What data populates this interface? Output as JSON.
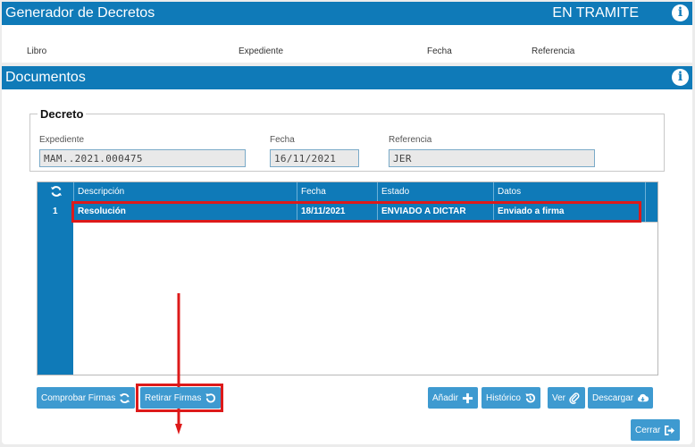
{
  "top": {
    "title": "Generador de Decretos",
    "state": "EN TRAMITE",
    "cut_labels": [
      "Libro",
      "Expediente",
      "Fecha",
      "Referencia"
    ]
  },
  "docs": {
    "title": "Documentos",
    "decreto": {
      "legend": "Decreto",
      "expediente_label": "Expediente",
      "expediente_value": "MAM..2021.000475",
      "fecha_label": "Fecha",
      "fecha_value": "16/11/2021",
      "referencia_label": "Referencia",
      "referencia_value": "JER"
    },
    "grid": {
      "headers": [
        "Descripción",
        "Fecha",
        "Estado",
        "Datos"
      ],
      "rows": [
        {
          "num": "1",
          "descripcion": "Resolución",
          "fecha": "18/11/2021",
          "estado": "ENVIADO A DICTAR",
          "datos": "Enviado a firma"
        }
      ]
    },
    "buttons": {
      "comprobar": "Comprobar Firmas",
      "retirar": "Retirar Firmas",
      "anadir": "Añadir",
      "historico": "Histórico",
      "ver": "Ver",
      "descargar": "Descargar",
      "cerrar": "Cerrar"
    }
  },
  "colors": {
    "accent": "#0f7ab8",
    "button": "#3e9ad0",
    "highlight": "#dd1a1a"
  },
  "icons": [
    "info-icon",
    "refresh-icon",
    "plus-icon",
    "history-icon",
    "paperclip-icon",
    "cloud-download-icon",
    "sign-out-icon",
    "undo-icon"
  ]
}
